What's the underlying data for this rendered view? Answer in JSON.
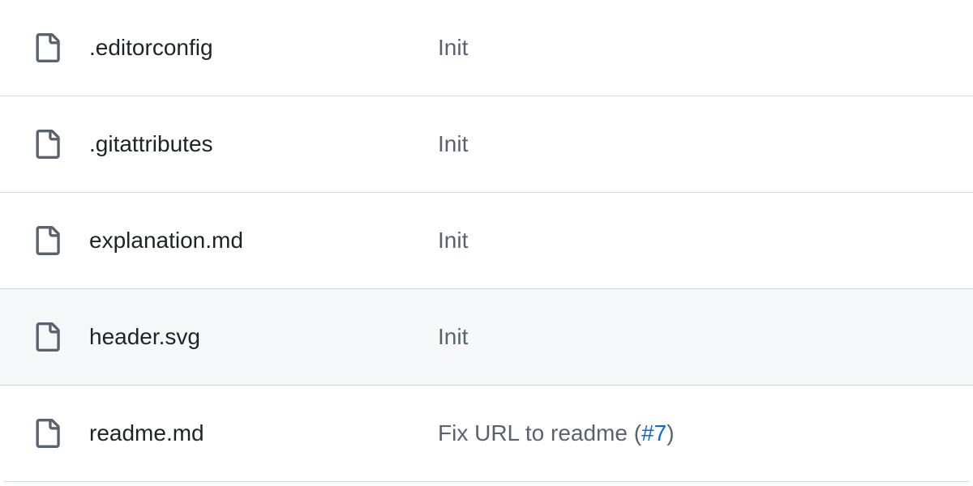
{
  "files": [
    {
      "name": ".editorconfig",
      "commit_message": "Init",
      "issue_ref": null,
      "hovered": false
    },
    {
      "name": ".gitattributes",
      "commit_message": "Init",
      "issue_ref": null,
      "hovered": false
    },
    {
      "name": "explanation.md",
      "commit_message": "Init",
      "issue_ref": null,
      "hovered": false
    },
    {
      "name": "header.svg",
      "commit_message": "Init",
      "issue_ref": null,
      "hovered": true
    },
    {
      "name": "readme.md",
      "commit_message": "Fix URL to readme (",
      "issue_ref": "#7",
      "message_suffix": ")",
      "hovered": false
    }
  ]
}
